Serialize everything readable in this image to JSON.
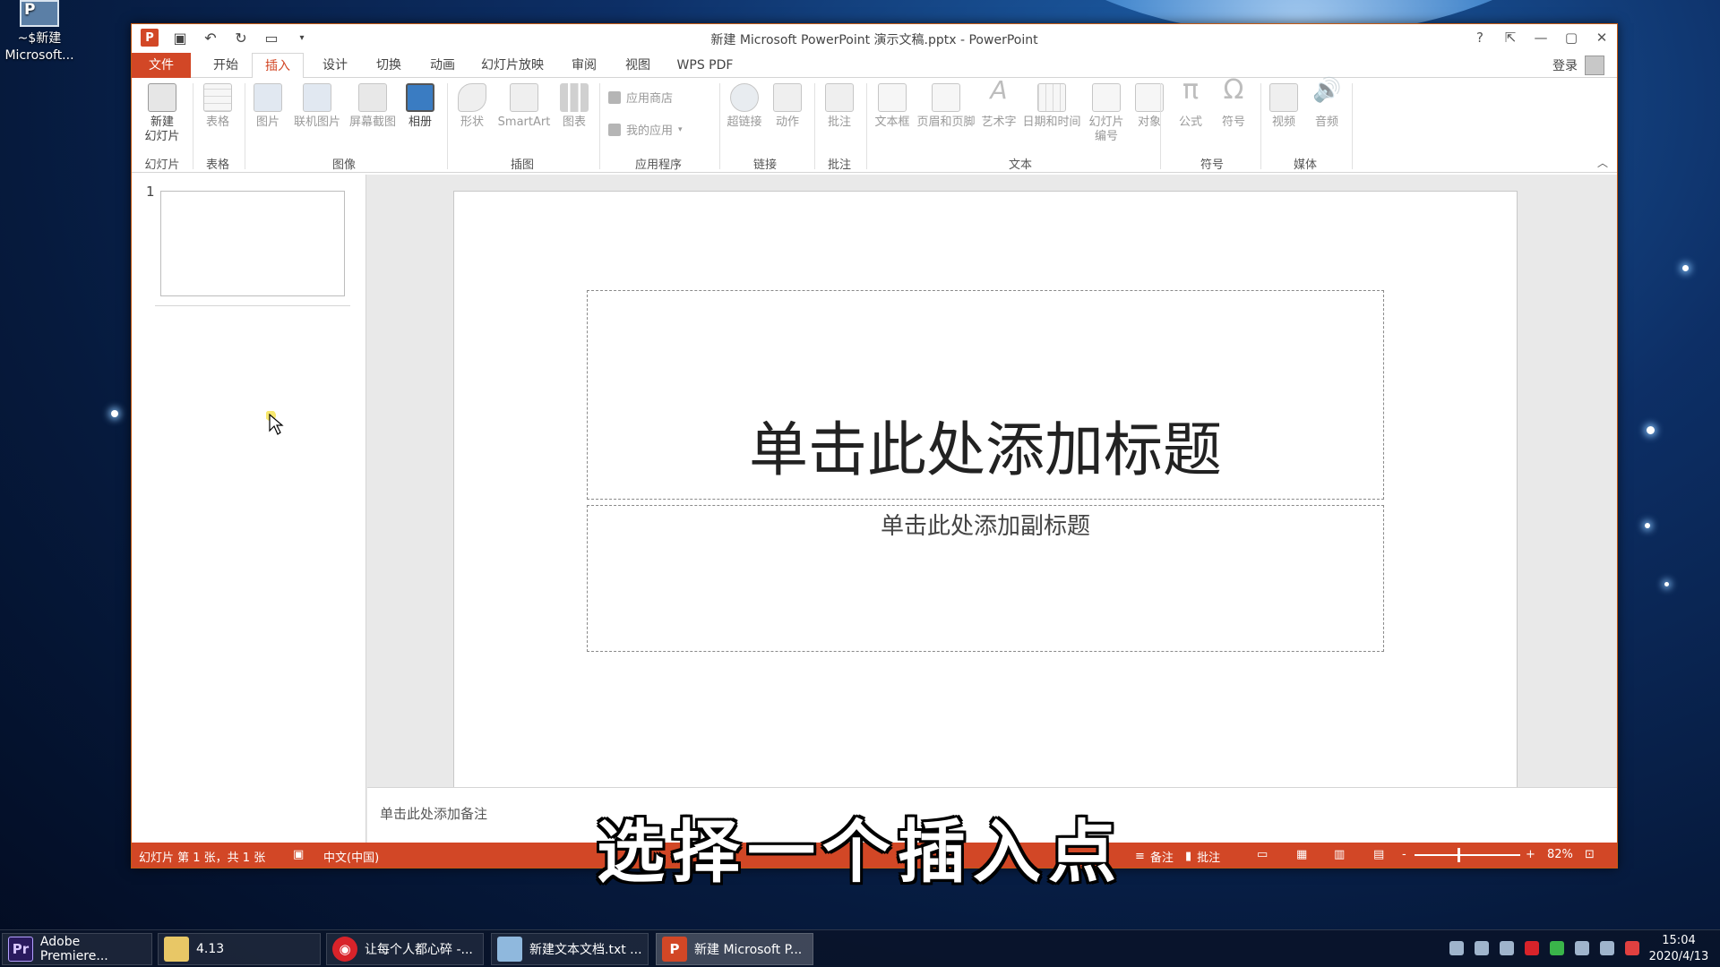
{
  "desktop": {
    "icon_label_1": "~$新建",
    "icon_label_2": "Microsoft..."
  },
  "window": {
    "title": "新建 Microsoft PowerPoint 演示文稿.pptx - PowerPoint",
    "help": "?",
    "login": "登录"
  },
  "tabs": [
    {
      "label": "文件"
    },
    {
      "label": "开始"
    },
    {
      "label": "插入"
    },
    {
      "label": "设计"
    },
    {
      "label": "切换"
    },
    {
      "label": "动画"
    },
    {
      "label": "幻灯片放映"
    },
    {
      "label": "审阅"
    },
    {
      "label": "视图"
    },
    {
      "label": "WPS PDF"
    }
  ],
  "ribbon": {
    "buttons": {
      "new_slide_1": "新建",
      "new_slide_2": "幻灯片",
      "table": "表格",
      "picture": "图片",
      "online_picture": "联机图片",
      "screenshot": "屏幕截图",
      "album": "相册",
      "shapes": "形状",
      "smartart": "SmartArt",
      "chart": "图表",
      "store": "应用商店",
      "my_apps": "我的应用",
      "hyperlink": "超链接",
      "action": "动作",
      "comment": "批注",
      "textbox": "文本框",
      "header_footer": "页眉和页脚",
      "wordart": "艺术字",
      "datetime": "日期和时间",
      "slide_number_1": "幻灯片",
      "slide_number_2": "编号",
      "object": "对象",
      "equation": "公式",
      "symbol": "符号",
      "video": "视频",
      "audio": "音频"
    },
    "groups": {
      "slides": "幻灯片",
      "tables": "表格",
      "images": "图像",
      "illustrations": "插图",
      "apps": "应用程序",
      "links": "链接",
      "comments": "批注",
      "text": "文本",
      "symbols": "符号",
      "media": "媒体"
    }
  },
  "thumbnails": {
    "slide_number": "1"
  },
  "slide": {
    "title_placeholder": "单击此处添加标题",
    "subtitle_placeholder": "单击此处添加副标题"
  },
  "notes": {
    "placeholder": "单击此处添加备注"
  },
  "status": {
    "slide_info": "幻灯片 第 1 张，共 1 张",
    "language": "中文(中国)",
    "notes": "备注",
    "comments": "批注",
    "zoom_minus": "-",
    "zoom_plus": "+",
    "zoom": "82%"
  },
  "caption": "选择一个插入点",
  "taskbar": {
    "items": [
      {
        "label": "Adobe Premiere...",
        "icon": "Pr"
      },
      {
        "label": "4.13",
        "icon": ""
      },
      {
        "label": "让每个人都心碎 -...",
        "icon": ""
      },
      {
        "label": "新建文本文档.txt ...",
        "icon": ""
      },
      {
        "label": "新建 Microsoft P...",
        "icon": "P"
      }
    ],
    "time": "15:04",
    "date": "2020/4/13"
  }
}
